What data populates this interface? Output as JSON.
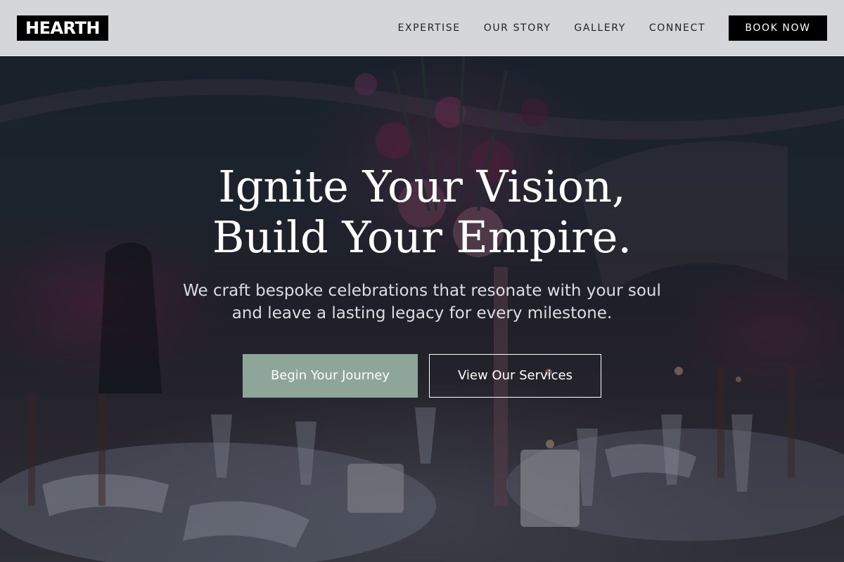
{
  "header": {
    "logo": "HEARTH",
    "nav": [
      {
        "label": "EXPERTISE"
      },
      {
        "label": "OUR STORY"
      },
      {
        "label": "GALLERY"
      },
      {
        "label": "CONNECT"
      }
    ],
    "cta_label": "BOOK NOW"
  },
  "hero": {
    "headline_line1": "Ignite Your Vision,",
    "headline_line2": "Build Your Empire.",
    "subtitle": "We craft bespoke celebrations that resonate with your soul and leave a lasting legacy for every milestone.",
    "primary_button": "Begin Your Journey",
    "secondary_button": "View Our Services",
    "background_description_icon": "banquet-photo"
  },
  "colors": {
    "header_bg": "#dedee2",
    "logo_bg": "#000000",
    "primary_button_bg": "#8ea69a",
    "text_light": "#ffffff"
  }
}
